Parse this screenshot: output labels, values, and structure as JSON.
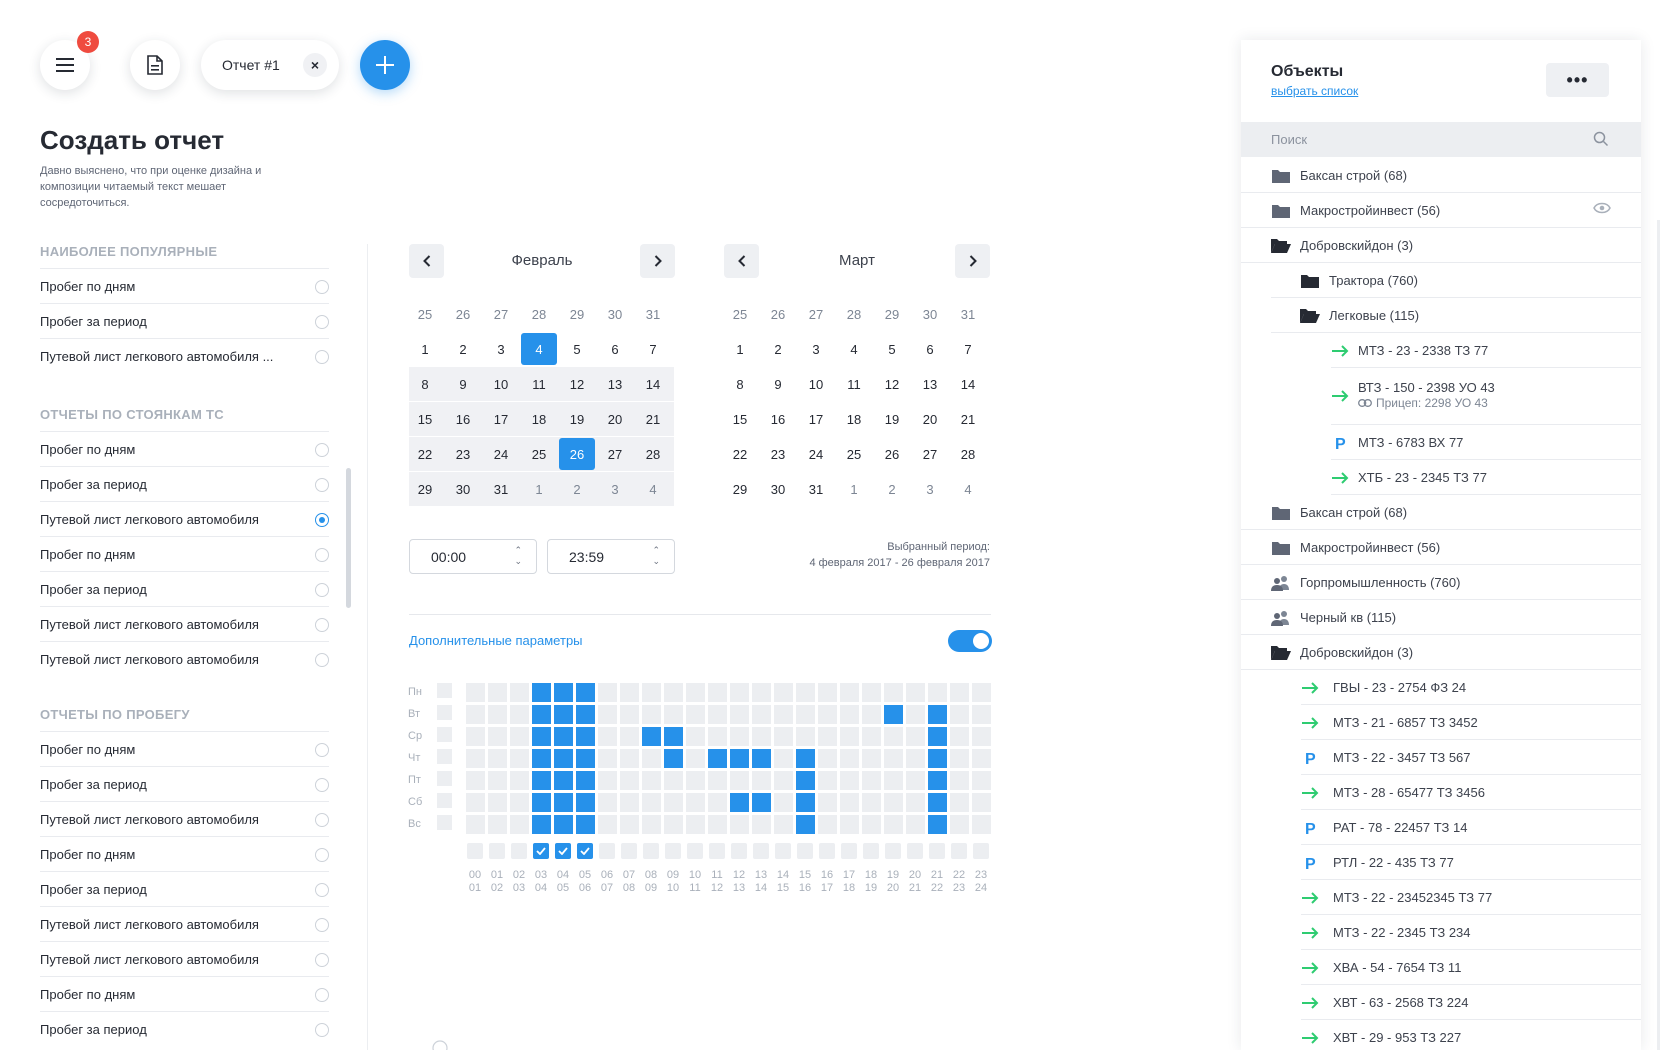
{
  "toolbar": {
    "menu_badge": "3",
    "tab_label": "Отчет #1",
    "tab_close": "×",
    "add_label": "+"
  },
  "page": {
    "title": "Создать отчет",
    "description": "Давно выяснено, что при оценке дизайна и композиции читаемый текст мешает сосредоточиться."
  },
  "sections": [
    {
      "title": "НАИБОЛЕЕ ПОПУЛЯРНЫЕ",
      "items": [
        {
          "label": "Пробег по дням",
          "selected": false
        },
        {
          "label": "Пробег за период",
          "selected": false
        },
        {
          "label": "Путевой лист легкового автомобиля ...",
          "selected": false
        }
      ]
    },
    {
      "title": "ОТЧЕТЫ ПО СТОЯНКАМ ТС",
      "items": [
        {
          "label": "Пробег по дням",
          "selected": false
        },
        {
          "label": "Пробег за период",
          "selected": false
        },
        {
          "label": "Путевой лист легкового автомобиля",
          "selected": true
        },
        {
          "label": "Пробег по дням",
          "selected": false
        },
        {
          "label": "Пробег за период",
          "selected": false
        },
        {
          "label": "Путевой лист легкового автомобиля",
          "selected": false
        },
        {
          "label": "Путевой лист легкового автомобиля",
          "selected": false
        }
      ]
    },
    {
      "title": "ОТЧЕТЫ ПО ПРОБЕГУ",
      "items": [
        {
          "label": "Пробег по дням",
          "selected": false
        },
        {
          "label": "Пробег за период",
          "selected": false
        },
        {
          "label": "Путевой лист легкового автомобиля",
          "selected": false
        },
        {
          "label": "Пробег по дням",
          "selected": false
        },
        {
          "label": "Пробег за период",
          "selected": false
        },
        {
          "label": "Путевой лист легкового автомобиля",
          "selected": false
        },
        {
          "label": "Путевой лист легкового автомобиля",
          "selected": false
        },
        {
          "label": "Пробег по дням",
          "selected": false
        },
        {
          "label": "Пробег за период",
          "selected": false
        }
      ]
    }
  ],
  "calendar": {
    "months": [
      {
        "name": "Февраль",
        "weeks": [
          [
            "25",
            "26",
            "27",
            "28",
            "29",
            "30",
            "31"
          ],
          [
            "1",
            "2",
            "3",
            "4",
            "5",
            "6",
            "7"
          ],
          [
            "8",
            "9",
            "10",
            "11",
            "12",
            "13",
            "14"
          ],
          [
            "15",
            "16",
            "17",
            "18",
            "19",
            "20",
            "21"
          ],
          [
            "22",
            "23",
            "24",
            "25",
            "26",
            "27",
            "28"
          ],
          [
            "29",
            "30",
            "31",
            "1",
            "2",
            "3",
            "4"
          ]
        ],
        "selected": [
          "1-3",
          "4-4"
        ],
        "highlighted_weeks": [
          1,
          2,
          3,
          4
        ],
        "muted": [
          "0-*",
          "5-3",
          "5-4",
          "5-5",
          "5-6"
        ]
      },
      {
        "name": "Март",
        "weeks": [
          [
            "25",
            "26",
            "27",
            "28",
            "29",
            "30",
            "31"
          ],
          [
            "1",
            "2",
            "3",
            "4",
            "5",
            "6",
            "7"
          ],
          [
            "8",
            "9",
            "10",
            "11",
            "12",
            "13",
            "14"
          ],
          [
            "15",
            "16",
            "17",
            "18",
            "19",
            "20",
            "21"
          ],
          [
            "22",
            "23",
            "24",
            "25",
            "26",
            "27",
            "28"
          ],
          [
            "29",
            "30",
            "31",
            "1",
            "2",
            "3",
            "4"
          ]
        ],
        "selected": [],
        "highlighted_weeks": [],
        "muted": [
          "0-*",
          "5-3",
          "5-4",
          "5-5",
          "5-6"
        ]
      }
    ],
    "time_from": "00:00",
    "time_to": "23:59",
    "period_label": "Выбранный период:",
    "period_value": "4 февраля 2017 - 26 февраля 2017"
  },
  "additional": {
    "label": "Дополнительные параметры",
    "enabled": true
  },
  "schedule": {
    "days": [
      "Пн",
      "Вт",
      "Ср",
      "Чт",
      "Пт",
      "Сб",
      "Вс"
    ],
    "hours_top": [
      "00",
      "01",
      "02",
      "03",
      "04",
      "05",
      "06",
      "07",
      "08",
      "09",
      "10",
      "11",
      "12",
      "13",
      "14",
      "15",
      "16",
      "17",
      "18",
      "19",
      "20",
      "21",
      "22",
      "23"
    ],
    "hours_bottom": [
      "01",
      "02",
      "03",
      "04",
      "05",
      "06",
      "07",
      "08",
      "09",
      "10",
      "11",
      "12",
      "13",
      "14",
      "15",
      "16",
      "17",
      "18",
      "19",
      "20",
      "21",
      "22",
      "23",
      "24"
    ],
    "checked_hours": [
      3,
      4,
      5
    ],
    "active": [
      [
        3,
        4,
        5
      ],
      [
        3,
        4,
        5,
        19,
        21
      ],
      [
        3,
        4,
        5,
        8,
        9,
        21
      ],
      [
        3,
        4,
        5,
        9,
        11,
        12,
        13,
        15,
        21
      ],
      [
        3,
        4,
        5,
        15,
        21
      ],
      [
        3,
        4,
        5,
        12,
        13,
        15,
        21
      ],
      [
        3,
        4,
        5,
        15,
        21
      ]
    ]
  },
  "objects": {
    "title": "Объекты",
    "link": "выбрать список",
    "search_placeholder": "Поиск",
    "items": [
      {
        "icon": "folder-icon",
        "label": "Баксан строй (68)",
        "level": 0
      },
      {
        "icon": "folder-icon",
        "label": "Макростройинвест (56)",
        "level": 0,
        "eye": true
      },
      {
        "icon": "folder-open-icon",
        "label": "Добровскийдон (3)",
        "level": 0
      },
      {
        "icon": "folder-dark-icon",
        "label": "Трактора (760)",
        "level": 1
      },
      {
        "icon": "folder-open-icon",
        "label": "Легковые (115)",
        "level": 1
      },
      {
        "icon": "arrow-icon",
        "label": "МТЗ - 23 - 2338 ТЗ 77",
        "level": 2
      },
      {
        "icon": "arrow-icon",
        "label": "ВТЗ - 150 - 2398 УО 43",
        "level": 2,
        "sub": "Прицеп: 2298 УО 43"
      },
      {
        "icon": "parking-icon",
        "label": "МТЗ - 6783 ВХ 77",
        "level": 2
      },
      {
        "icon": "arrow-icon",
        "label": "ХТБ - 23 - 2345 ТЗ 77",
        "level": 2
      },
      {
        "icon": "folder-icon",
        "label": "Баксан строй (68)",
        "level": 0
      },
      {
        "icon": "folder-icon",
        "label": "Макростройинвест (56)",
        "level": 0
      },
      {
        "icon": "group-icon",
        "label": "Горпромышленность (760)",
        "level": 0
      },
      {
        "icon": "group-icon",
        "label": "Черный кв (115)",
        "level": 0
      },
      {
        "icon": "folder-open-icon",
        "label": "Добровскийдон (3)",
        "level": 0
      },
      {
        "icon": "arrow-icon",
        "label": "ГВЫ - 23 - 2754 ФЗ 24",
        "level": 3
      },
      {
        "icon": "arrow-icon",
        "label": "МТЗ - 21 - 6857 ТЗ 3452",
        "level": 3
      },
      {
        "icon": "parking-icon",
        "label": "МТЗ - 22 - 3457 ТЗ 567",
        "level": 3
      },
      {
        "icon": "arrow-icon",
        "label": "МТЗ - 28 - 65477 ТЗ 3456",
        "level": 3
      },
      {
        "icon": "parking-icon",
        "label": "РАТ - 78 - 22457 ТЗ 14",
        "level": 3
      },
      {
        "icon": "parking-icon",
        "label": "РТЛ - 22 - 435 ТЗ 77",
        "level": 3
      },
      {
        "icon": "arrow-icon",
        "label": "МТЗ - 22 - 23452345 ТЗ 77",
        "level": 3
      },
      {
        "icon": "arrow-icon",
        "label": "МТЗ - 22 - 2345 ТЗ 234",
        "level": 3
      },
      {
        "icon": "arrow-icon",
        "label": "ХВА - 54 - 7654 ТЗ 11",
        "level": 3
      },
      {
        "icon": "arrow-icon",
        "label": "ХВТ - 63 - 2568 ТЗ 224",
        "level": 3
      },
      {
        "icon": "arrow-icon",
        "label": "ХВТ - 29 - 953 ТЗ 227",
        "level": 3
      }
    ]
  },
  "colors": {
    "accent": "#2691ea",
    "badge": "#ef4b3f",
    "green": "#2ecc71"
  }
}
